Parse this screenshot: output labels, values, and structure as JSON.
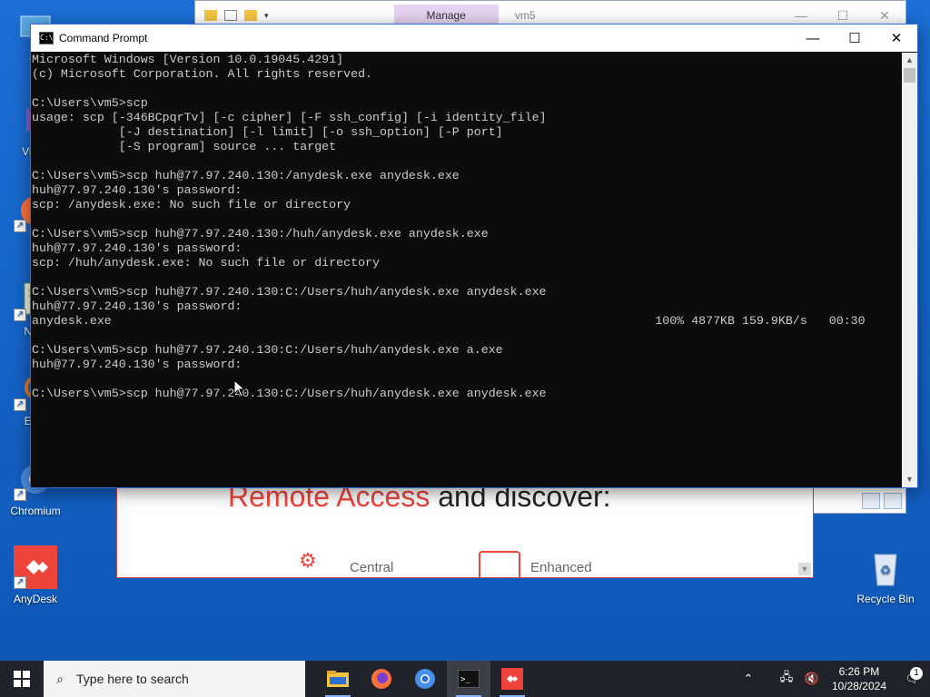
{
  "desktop": {
    "icons": [
      {
        "label": "Th",
        "icon": "this-pc-icon"
      },
      {
        "label": "Visua",
        "icon": "visual-studio-icon"
      },
      {
        "label": "Fi",
        "icon": "firefox-icon"
      },
      {
        "label": "Note",
        "icon": "notepad-icon"
      },
      {
        "label": "Ever",
        "icon": "everything-icon"
      },
      {
        "label": "Chromium",
        "icon": "chromium-icon"
      },
      {
        "label": "AnyDesk",
        "icon": "anydesk-icon"
      },
      {
        "label": "Recycle Bin",
        "icon": "recycle-bin-icon"
      }
    ]
  },
  "explorer": {
    "manage_tab": "Manage",
    "title": "vm5"
  },
  "anydesk_window": {
    "headline_red": "Remote Access",
    "headline_rest": " and discover:",
    "feature_1": "Central",
    "feature_2": "Enhanced",
    "colors": {
      "accent": "#ef443b"
    }
  },
  "cmd": {
    "title": "Command Prompt",
    "minimize_label": "—",
    "maximize_label": "☐",
    "close_label": "✕",
    "output": "Microsoft Windows [Version 10.0.19045.4291]\n(c) Microsoft Corporation. All rights reserved.\n\nC:\\Users\\vm5>scp\nusage: scp [-346BCpqrTv] [-c cipher] [-F ssh_config] [-i identity_file]\n            [-J destination] [-l limit] [-o ssh_option] [-P port]\n            [-S program] source ... target\n\nC:\\Users\\vm5>scp huh@77.97.240.130:/anydesk.exe anydesk.exe\nhuh@77.97.240.130's password:\nscp: /anydesk.exe: No such file or directory\n\nC:\\Users\\vm5>scp huh@77.97.240.130:/huh/anydesk.exe anydesk.exe\nhuh@77.97.240.130's password:\nscp: /huh/anydesk.exe: No such file or directory\n\nC:\\Users\\vm5>scp huh@77.97.240.130:C:/Users/huh/anydesk.exe anydesk.exe\nhuh@77.97.240.130's password:\nanydesk.exe                                                                           100% 4877KB 159.9KB/s   00:30\n\nC:\\Users\\vm5>scp huh@77.97.240.130:C:/Users/huh/anydesk.exe a.exe\nhuh@77.97.240.130's password:\n\nC:\\Users\\vm5>scp huh@77.97.240.130:C:/Users/huh/anydesk.exe anydesk.exe"
  },
  "taskbar": {
    "search_placeholder": "Type here to search",
    "apps": [
      {
        "name": "file-explorer",
        "icon": "folder-icon"
      },
      {
        "name": "firefox",
        "icon": "firefox-icon"
      },
      {
        "name": "chromium",
        "icon": "chromium-icon"
      },
      {
        "name": "command-prompt",
        "icon": "terminal-icon"
      },
      {
        "name": "anydesk",
        "icon": "anydesk-icon"
      }
    ],
    "time": "6:26 PM",
    "date": "10/28/2024",
    "notification_count": "1"
  }
}
